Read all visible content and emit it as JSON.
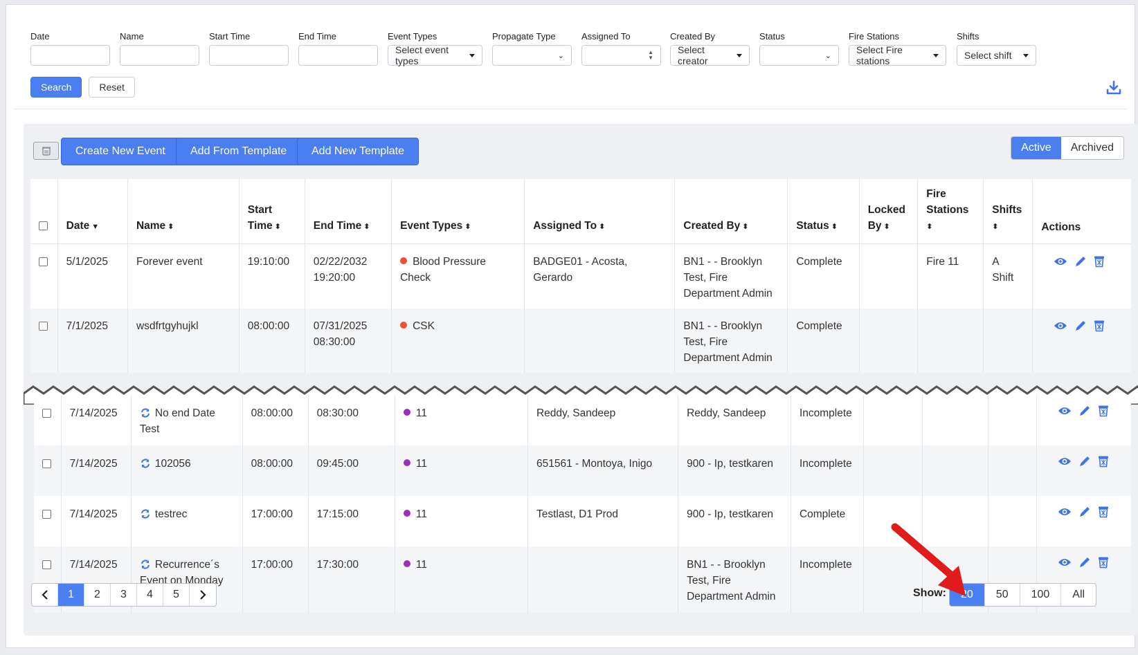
{
  "filters": {
    "date": {
      "label": "Date",
      "value": ""
    },
    "name": {
      "label": "Name",
      "value": ""
    },
    "start_time": {
      "label": "Start Time",
      "value": ""
    },
    "end_time": {
      "label": "End Time",
      "value": ""
    },
    "event_types": {
      "label": "Event Types",
      "value": "Select event types"
    },
    "propagate_type": {
      "label": "Propagate Type",
      "value": ""
    },
    "assigned_to": {
      "label": "Assigned To",
      "value": ""
    },
    "created_by": {
      "label": "Created By",
      "value": "Select creator"
    },
    "status": {
      "label": "Status",
      "value": ""
    },
    "fire_stations": {
      "label": "Fire Stations",
      "value": "Select Fire stations"
    },
    "shifts": {
      "label": "Shifts",
      "value": "Select shift"
    },
    "search_label": "Search",
    "reset_label": "Reset"
  },
  "toolbar": {
    "create_label": "Create New Event",
    "add_from_template_label": "Add From Template",
    "add_new_template_label": "Add New Template",
    "active_label": "Active",
    "archived_label": "Archived"
  },
  "columns": {
    "date": "Date",
    "name": "Name",
    "start_time_1": "Start",
    "start_time_2": "Time",
    "end_time": "End Time",
    "event_types": "Event Types",
    "assigned_to": "Assigned To",
    "created_by": "Created By",
    "status": "Status",
    "locked_1": "Locked",
    "locked_2": "By",
    "fire_1": "Fire",
    "fire_2": "Stations",
    "shifts": "Shifts",
    "actions": "Actions"
  },
  "rows_top": [
    {
      "date": "5/1/2025",
      "name": "Forever event",
      "start": "19:10:00",
      "end_1": "02/22/2032",
      "end_2": "19:20:00",
      "event_1": "Blood Pressure",
      "event_2": "Check",
      "event_color": "#f1502f",
      "assigned_1": "BADGE01 - Acosta,",
      "assigned_2": "Gerardo",
      "created_1": "BN1 - - Brooklyn",
      "created_2": "Test, Fire",
      "created_3": "Department Admin",
      "status": "Complete",
      "locked": "",
      "fire": "Fire 11",
      "shift_1": "A",
      "shift_2": "Shift"
    },
    {
      "date": "7/1/2025",
      "name": "wsdfrtgyhujkl",
      "start": "08:00:00",
      "end_1": "07/31/2025",
      "end_2": "08:30:00",
      "event_1": "CSK",
      "event_2": "",
      "event_color": "#f1502f",
      "assigned_1": "",
      "assigned_2": "",
      "created_1": "BN1 - - Brooklyn",
      "created_2": "Test, Fire",
      "created_3": "Department Admin",
      "status": "Complete",
      "locked": "",
      "fire": "",
      "shift_1": "",
      "shift_2": ""
    }
  ],
  "rows_bottom": [
    {
      "date": "7/14/2025",
      "name_1": "No end Date",
      "name_2": "Test",
      "start": "08:00:00",
      "end": "08:30:00",
      "event": "11",
      "event_color": "#9b2fb8",
      "assigned": "Reddy, Sandeep",
      "created_1": "Reddy, Sandeep",
      "created_2": "",
      "created_3": "",
      "status": "Incomplete"
    },
    {
      "date": "7/14/2025",
      "name_1": "102056",
      "name_2": "",
      "start": "08:00:00",
      "end": "09:45:00",
      "event": "11",
      "event_color": "#9b2fb8",
      "assigned": "651561 - Montoya, Inigo",
      "created_1": "900 - Ip, testkaren",
      "created_2": "",
      "created_3": "",
      "status": "Incomplete"
    },
    {
      "date": "7/14/2025",
      "name_1": "testrec",
      "name_2": "",
      "start": "17:00:00",
      "end": "17:15:00",
      "event": "11",
      "event_color": "#9b2fb8",
      "assigned": "Testlast, D1 Prod",
      "created_1": "900 - Ip, testkaren",
      "created_2": "",
      "created_3": "",
      "status": "Complete"
    },
    {
      "date": "7/14/2025",
      "name_1": "Recurrence´s",
      "name_2": "Event on Monday",
      "start": "17:00:00",
      "end": "17:30:00",
      "event": "11",
      "event_color": "#9b2fb8",
      "assigned": "",
      "created_1": "BN1 - - Brooklyn",
      "created_2": "Test, Fire",
      "created_3": "Department Admin",
      "status": "Incomplete"
    }
  ],
  "pagination": {
    "pages": [
      "1",
      "2",
      "3",
      "4",
      "5"
    ],
    "current": "1",
    "show_label": "Show:",
    "sizes": [
      "20",
      "50",
      "100",
      "All"
    ],
    "current_size": "20"
  },
  "colors": {
    "accent": "#4a7ff2",
    "annotation_arrow": "#e01b1b"
  }
}
